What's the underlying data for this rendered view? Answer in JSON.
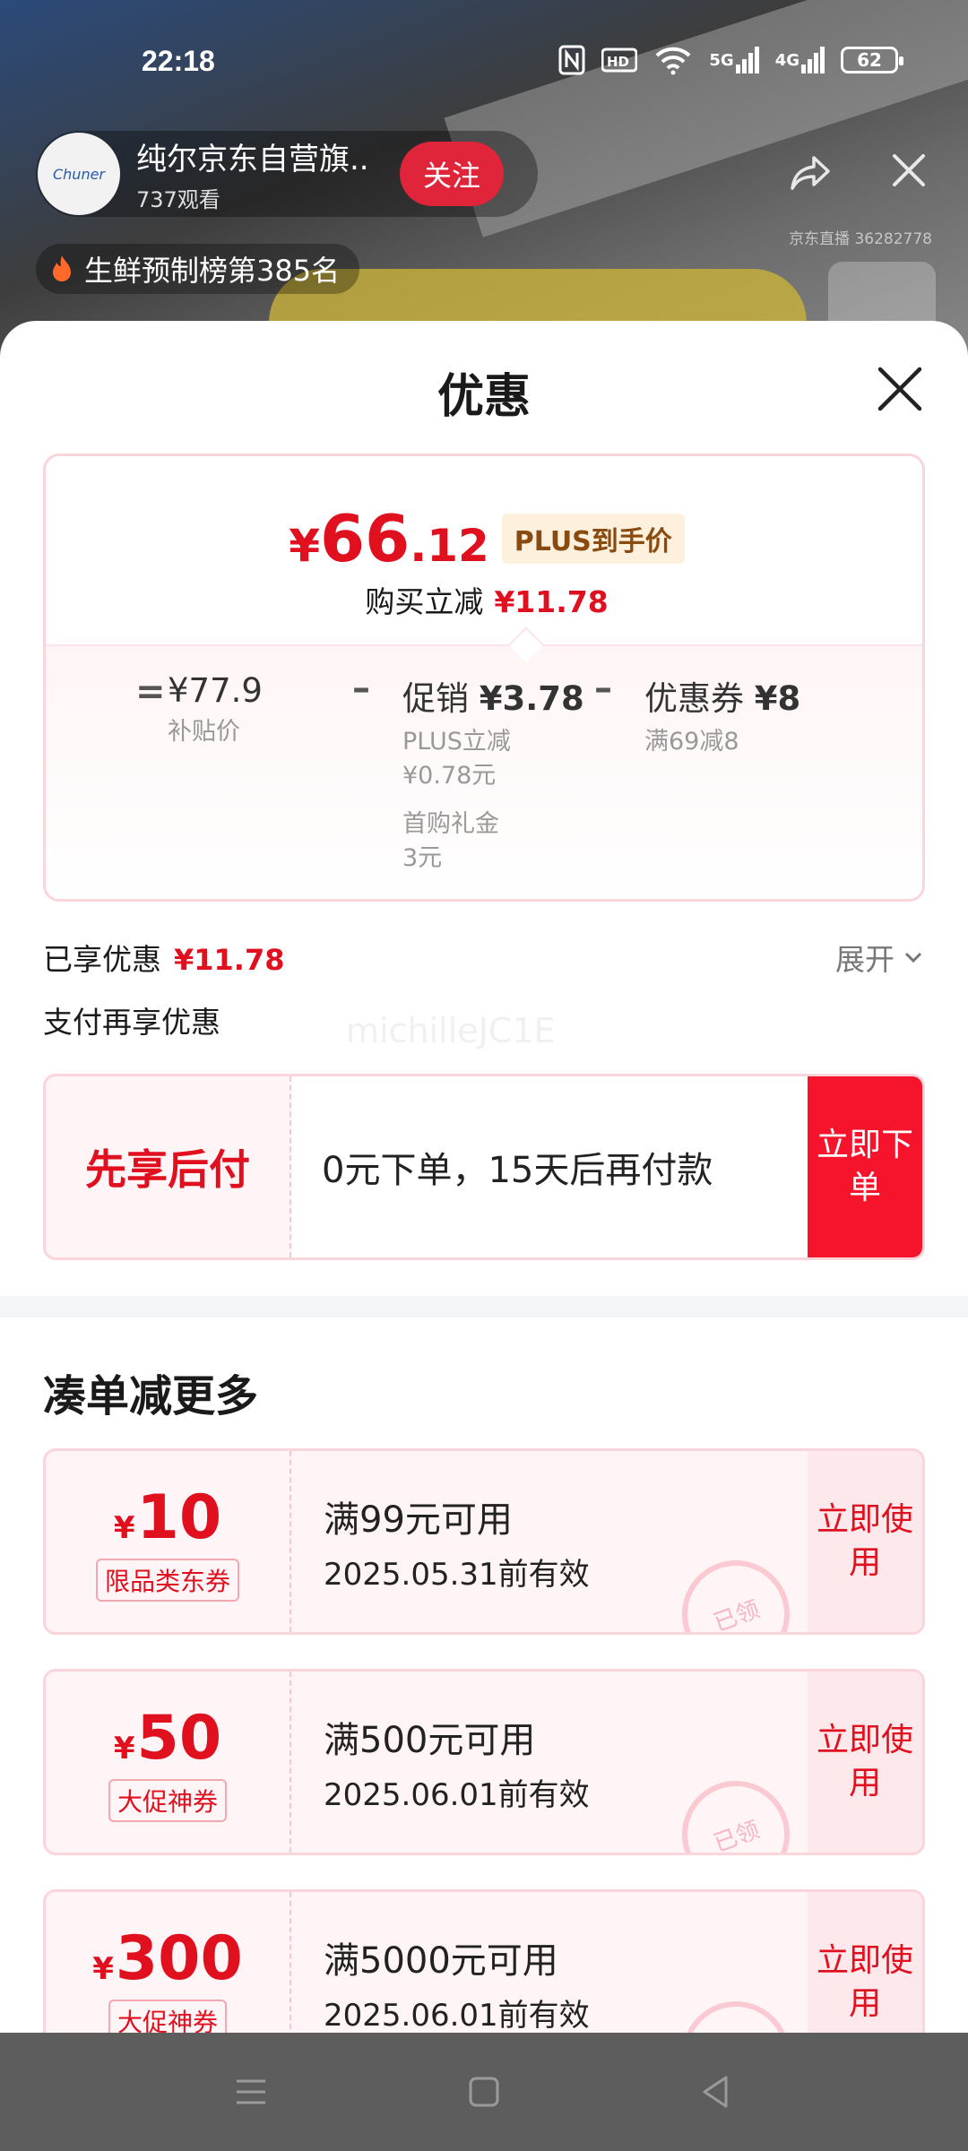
{
  "status_bar": {
    "time": "22:18",
    "network_5g": "5G",
    "network_4g": "4G",
    "battery": "62"
  },
  "live": {
    "shop_name": "纯尔京东自营旗..",
    "viewers": "737观看",
    "follow_label": "关注",
    "live_id": "京东直播 36282778",
    "rank": "生鲜预制榜第385名",
    "avatar_text": "Chuner"
  },
  "sheet": {
    "title": "优惠"
  },
  "price": {
    "yen": "¥",
    "integer": "66",
    "decimal": ".12",
    "plus_tag": "PLUS到手价",
    "reduce_label": "购买立减",
    "reduce_value": "¥11.78",
    "equals": "=",
    "minus": "–",
    "subsidy_value": "¥77.9",
    "subsidy_label": "补贴价",
    "promo_label": "促销",
    "promo_value": "¥3.78",
    "promo_detail_1": "PLUS立减",
    "promo_detail_1_val": "¥0.78元",
    "promo_detail_2": "首购礼金",
    "promo_detail_2_val": "3元",
    "coupon_label": "优惠券",
    "coupon_value": "¥8",
    "coupon_detail": "满69减8"
  },
  "enjoyed": {
    "label": "已享优惠",
    "value": "¥11.78",
    "expand_label": "展开"
  },
  "pay_more": {
    "label": "支付再享优惠",
    "watermark": "michilleJC1E"
  },
  "pay_later": {
    "title": "先享后付",
    "desc": "0元下单，15天后再付款",
    "button": "立即下单"
  },
  "more_section": {
    "title": "凑单减更多"
  },
  "coupons": [
    {
      "yen": "¥",
      "amount": "10",
      "tag": "限品类东券",
      "condition": "满99元可用",
      "validity": "2025.05.31前有效",
      "button": "立即使用",
      "stamp": "已领"
    },
    {
      "yen": "¥",
      "amount": "50",
      "tag": "大促神券",
      "condition": "满500元可用",
      "validity": "2025.06.01前有效",
      "button": "立即使用",
      "stamp": "已领"
    },
    {
      "yen": "¥",
      "amount": "300",
      "tag": "大促神券",
      "condition": "满5000元可用",
      "validity": "2025.06.01前有效",
      "button": "立即使用",
      "stamp": "已领"
    }
  ],
  "colors": {
    "accent_red": "#e0101f",
    "button_red": "#f5142c",
    "plus_gold": "#8a4b10"
  }
}
